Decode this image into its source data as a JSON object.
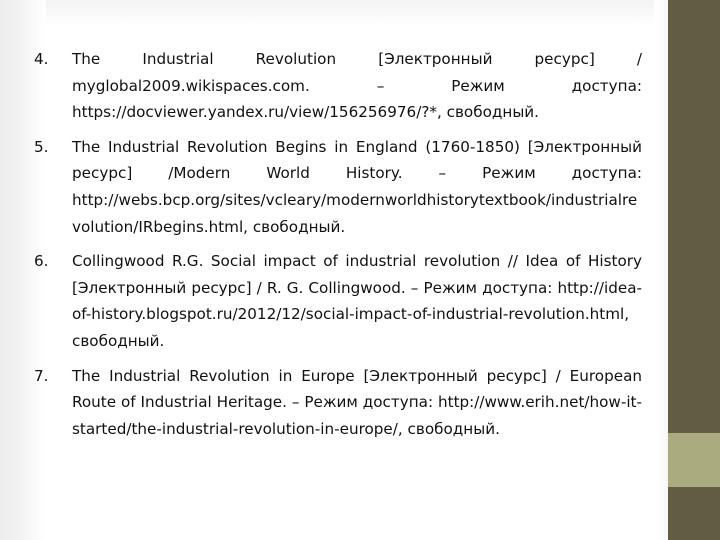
{
  "slide": {
    "background_color": "#ffffff",
    "text_color": "#111111",
    "accent_bar_color": "#625c45",
    "accent_band_color": "#abab80"
  },
  "references": {
    "items": [
      {
        "marker": "4.",
        "text": "The Industrial Revolution [Электронный ресурс] / myglobal2009.wikispaces.com. – Режим доступа: https://docviewer.yandex.ru/view/156256976/?*, свободный."
      },
      {
        "marker": "5.",
        "text": "The Industrial Revolution Begins in England (1760-1850) [Электронный ресурс] /Modern World History. – Режим доступа: http://webs.bcp.org/sites/vcleary/modernworldhistorytextbook/industrialrevolution/IRbegins.html, свободный."
      },
      {
        "marker": "6.",
        "text": "Collingwood R.G. Social impact of industrial revolution // Idea of History [Электронный ресурс] / R. G. Collingwood. – Режим доступа: http://idea-of-history.blogspot.ru/2012/12/social-impact-of-industrial-revolution.html, свободный."
      },
      {
        "marker": "7.",
        "text": "The Industrial Revolution in Europe [Электронный ресурс] / European Route of Industrial Heritage. – Режим доступа: http://www.erih.net/how-it-started/the-industrial-revolution-in-europe/, свободный."
      }
    ]
  }
}
